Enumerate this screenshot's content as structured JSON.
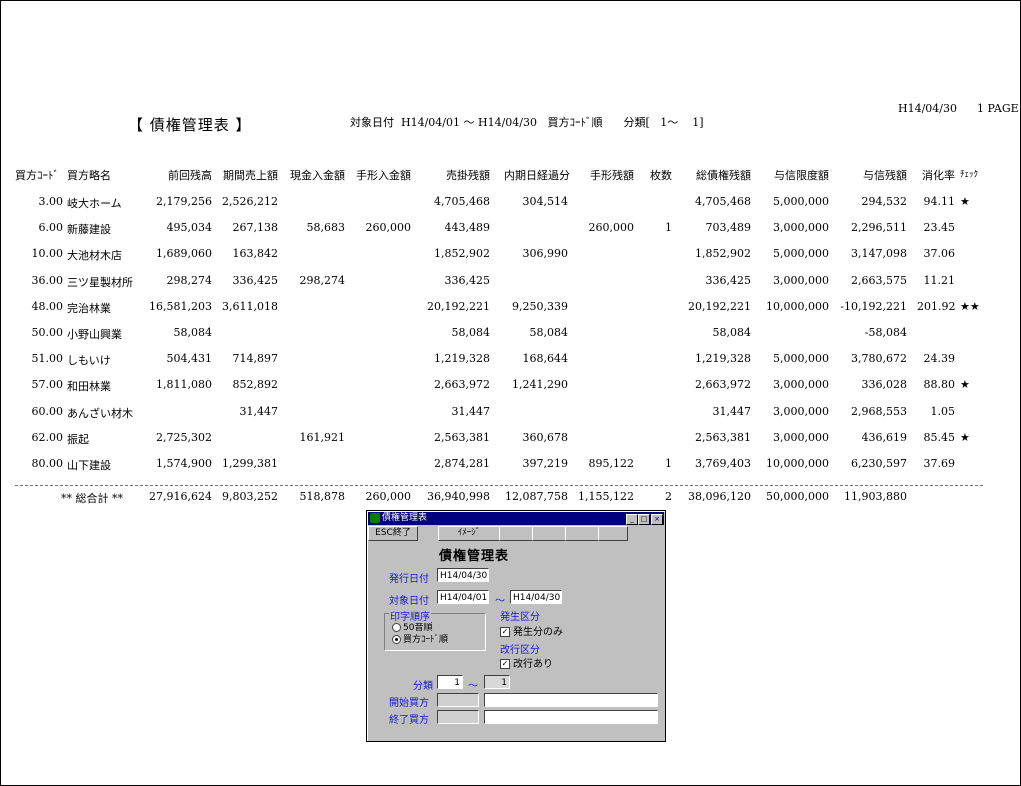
{
  "report": {
    "page_date": "H14/04/30",
    "page_no": "1 PAGE",
    "title": "【 債権管理表 】",
    "conditions": "対象日付  H14/04/01 ～ H14/04/30   買方ｺｰﾄﾞ順      分類[   1～    1]"
  },
  "columns": [
    "買方ｺｰﾄﾞ",
    "買方略名",
    "前回残高",
    "期間売上額",
    "現金入金額",
    "手形入金額",
    "売掛残額",
    "内期日経過分",
    "手形残額",
    "枚数",
    "総債権残額",
    "与信限度額",
    "与信残額",
    "消化率",
    "ﾁｪｯｸ"
  ],
  "rows": [
    [
      "3.00",
      "岐大ホーム",
      "2,179,256",
      "2,526,212",
      "",
      "",
      "4,705,468",
      "304,514",
      "",
      "",
      "4,705,468",
      "5,000,000",
      "294,532",
      "94.11",
      "★"
    ],
    [
      "6.00",
      "新藤建設",
      "495,034",
      "267,138",
      "58,683",
      "260,000",
      "443,489",
      "",
      "260,000",
      "1",
      "703,489",
      "3,000,000",
      "2,296,511",
      "23.45",
      ""
    ],
    [
      "10.00",
      "大池材木店",
      "1,689,060",
      "163,842",
      "",
      "",
      "1,852,902",
      "306,990",
      "",
      "",
      "1,852,902",
      "5,000,000",
      "3,147,098",
      "37.06",
      ""
    ],
    [
      "36.00",
      "三ツ星製材所",
      "298,274",
      "336,425",
      "298,274",
      "",
      "336,425",
      "",
      "",
      "",
      "336,425",
      "3,000,000",
      "2,663,575",
      "11.21",
      ""
    ],
    [
      "48.00",
      "完治林業",
      "16,581,203",
      "3,611,018",
      "",
      "",
      "20,192,221",
      "9,250,339",
      "",
      "",
      "20,192,221",
      "10,000,000",
      "-10,192,221",
      "201.92",
      "★★"
    ],
    [
      "50.00",
      "小野山興業",
      "58,084",
      "",
      "",
      "",
      "58,084",
      "58,084",
      "",
      "",
      "58,084",
      "",
      "-58,084",
      "",
      ""
    ],
    [
      "51.00",
      "しもいけ",
      "504,431",
      "714,897",
      "",
      "",
      "1,219,328",
      "168,644",
      "",
      "",
      "1,219,328",
      "5,000,000",
      "3,780,672",
      "24.39",
      ""
    ],
    [
      "57.00",
      "和田林業",
      "1,811,080",
      "852,892",
      "",
      "",
      "2,663,972",
      "1,241,290",
      "",
      "",
      "2,663,972",
      "3,000,000",
      "336,028",
      "88.80",
      "★"
    ],
    [
      "60.00",
      "あんざい材木",
      "",
      "31,447",
      "",
      "",
      "31,447",
      "",
      "",
      "",
      "31,447",
      "3,000,000",
      "2,968,553",
      "1.05",
      ""
    ],
    [
      "62.00",
      "振起",
      "2,725,302",
      "",
      "161,921",
      "",
      "2,563,381",
      "360,678",
      "",
      "",
      "2,563,381",
      "3,000,000",
      "436,619",
      "85.45",
      "★"
    ],
    [
      "80.00",
      "山下建設",
      "1,574,900",
      "1,299,381",
      "",
      "",
      "2,874,281",
      "397,219",
      "895,122",
      "1",
      "3,769,403",
      "10,000,000",
      "6,230,597",
      "37.69",
      ""
    ]
  ],
  "total": [
    "** 総合計 **",
    "27,916,624",
    "9,803,252",
    "518,878",
    "260,000",
    "36,940,998",
    "12,087,758",
    "1,155,122",
    "2",
    "38,096,120",
    "50,000,000",
    "11,903,880"
  ],
  "dialog": {
    "window_title": "債権管理表",
    "minimize_label": "_",
    "maximize_label": "□",
    "close_label": "×",
    "buttons": [
      "ESC終了",
      "ｲﾒｰｼﾞ",
      "",
      "",
      "",
      ""
    ],
    "heading": "債権管理表",
    "issue_date_label": "発行日付",
    "issue_date": "H14/04/30",
    "target_date_label": "対象日付",
    "target_from": "H14/04/01",
    "range_sep": "～",
    "target_to": "H14/04/30",
    "print_order_label": "印字順序",
    "order_options": [
      "50音順",
      "買方ｺｰﾄﾞ順"
    ],
    "selected_order": 1,
    "occurrence_label": "発生区分",
    "occurrence_option": "発生分のみ",
    "occurrence_checked": true,
    "pagebreak_label": "改行区分",
    "pagebreak_option": "改行あり",
    "pagebreak_checked": true,
    "category_label": "分類",
    "category_from": "1",
    "category_to": "1",
    "start_buyer_label": "開始買方",
    "end_buyer_label": "終了買方",
    "start_buyer_code": "",
    "start_buyer_name": "",
    "end_buyer_code": "",
    "end_buyer_name": ""
  }
}
